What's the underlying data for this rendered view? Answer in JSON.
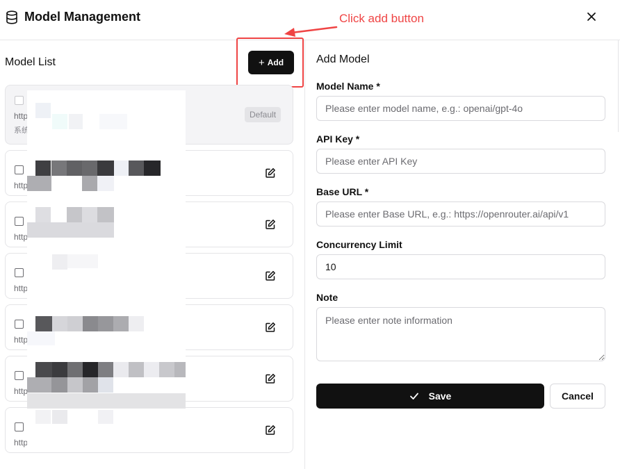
{
  "header": {
    "title": "Model Management",
    "icon": "database-icon",
    "close_icon": "close-icon"
  },
  "annotation": {
    "text": "Click add button",
    "color": "#ef4444"
  },
  "left": {
    "title": "Model List",
    "add_label": "Add",
    "models": [
      {
        "url_prefix": "http",
        "sub": "系统",
        "badge": "Default",
        "is_default": true
      },
      {
        "url_prefix": "http"
      },
      {
        "url_prefix": "http"
      },
      {
        "url_prefix": "http"
      },
      {
        "url_prefix": "http"
      },
      {
        "url_prefix": "http",
        "name_suffix": "4"
      },
      {
        "url_prefix": "http"
      }
    ]
  },
  "form": {
    "title": "Add Model",
    "model_name_label": "Model Name *",
    "model_name_placeholder": "Please enter model name, e.g.: openai/gpt-4o",
    "api_key_label": "API Key *",
    "api_key_placeholder": "Please enter API Key",
    "base_url_label": "Base URL *",
    "base_url_placeholder": "Please enter Base URL, e.g.: https://openrouter.ai/api/v1",
    "concurrency_label": "Concurrency Limit",
    "concurrency_value": "10",
    "note_label": "Note",
    "note_placeholder": "Please enter note information",
    "save_label": "Save",
    "cancel_label": "Cancel"
  },
  "colors": {
    "primary": "#111111",
    "border": "#e4e4e7",
    "annotation": "#ef4444"
  }
}
